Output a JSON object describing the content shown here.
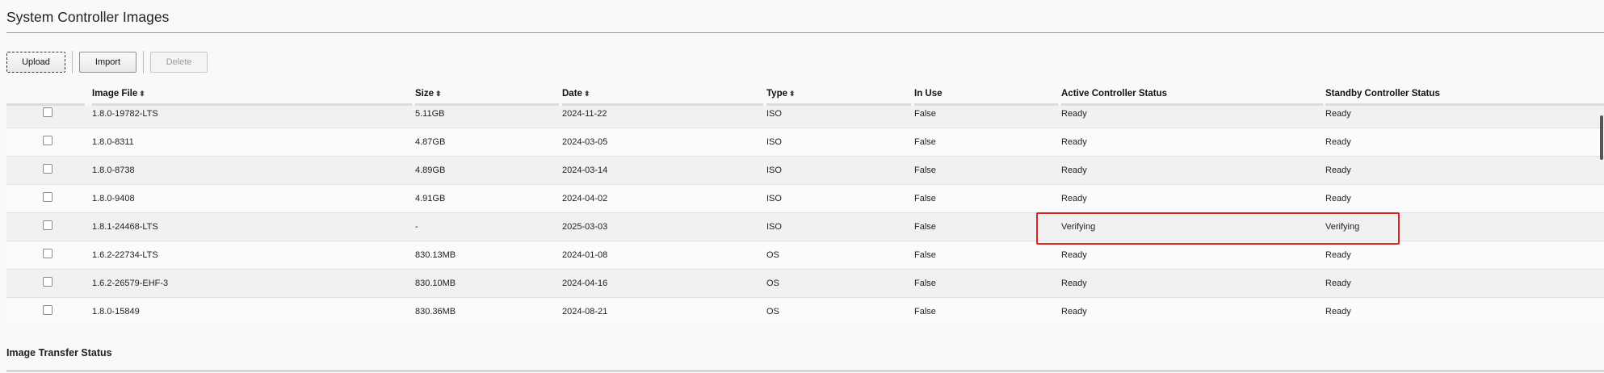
{
  "page": {
    "title": "System Controller Images"
  },
  "toolbar": {
    "upload": "Upload",
    "import": "Import",
    "delete": "Delete"
  },
  "table": {
    "columns": [
      {
        "label": "Image File",
        "sort": "⬍"
      },
      {
        "label": "Size",
        "sort": "⬍"
      },
      {
        "label": "Date",
        "sort": "⬍"
      },
      {
        "label": "Type",
        "sort": "⬍"
      },
      {
        "label": "In Use",
        "sort": ""
      },
      {
        "label": "Active Controller Status",
        "sort": ""
      },
      {
        "label": "Standby Controller Status",
        "sort": ""
      }
    ],
    "rows": [
      {
        "image": "1.8.0-19782-LTS",
        "size": "5.11GB",
        "date": "2024-11-22",
        "type": "ISO",
        "in_use": "False",
        "active": "Ready",
        "standby": "Ready"
      },
      {
        "image": "1.8.0-8311",
        "size": "4.87GB",
        "date": "2024-03-05",
        "type": "ISO",
        "in_use": "False",
        "active": "Ready",
        "standby": "Ready"
      },
      {
        "image": "1.8.0-8738",
        "size": "4.89GB",
        "date": "2024-03-14",
        "type": "ISO",
        "in_use": "False",
        "active": "Ready",
        "standby": "Ready"
      },
      {
        "image": "1.8.0-9408",
        "size": "4.91GB",
        "date": "2024-04-02",
        "type": "ISO",
        "in_use": "False",
        "active": "Ready",
        "standby": "Ready"
      },
      {
        "image": "1.8.1-24468-LTS",
        "size": "-",
        "date": "2025-03-03",
        "type": "ISO",
        "in_use": "False",
        "active": "Verifying",
        "standby": "Verifying"
      },
      {
        "image": "1.6.2-22734-LTS",
        "size": "830.13MB",
        "date": "2024-01-08",
        "type": "OS",
        "in_use": "False",
        "active": "Ready",
        "standby": "Ready"
      },
      {
        "image": "1.6.2-26579-EHF-3",
        "size": "830.10MB",
        "date": "2024-04-16",
        "type": "OS",
        "in_use": "False",
        "active": "Ready",
        "standby": "Ready"
      },
      {
        "image": "1.8.0-15849",
        "size": "830.36MB",
        "date": "2024-08-21",
        "type": "OS",
        "in_use": "False",
        "active": "Ready",
        "standby": "Ready"
      }
    ]
  },
  "transfer": {
    "title": "Image Transfer Status"
  },
  "colors": {
    "highlight": "#e0241b"
  }
}
